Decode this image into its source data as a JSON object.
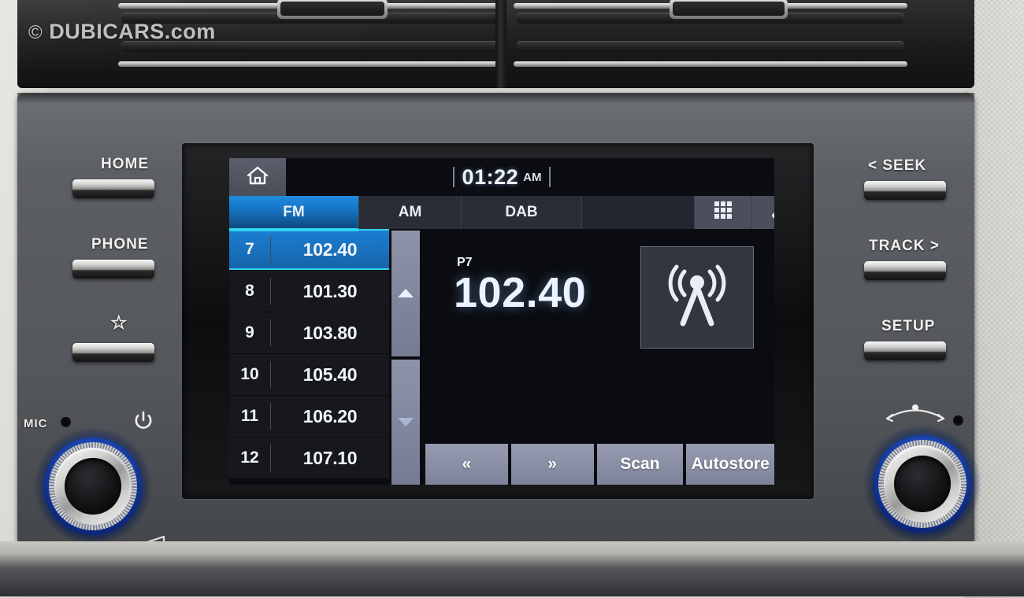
{
  "watermark": {
    "copyright": "©",
    "text": "DUBICARS.com"
  },
  "screen": {
    "status": {
      "home_icon": "home-icon",
      "clock_time": "01:22",
      "clock_ampm": "AM"
    },
    "tabs": [
      {
        "label": "FM",
        "active": true
      },
      {
        "label": "AM",
        "active": false
      },
      {
        "label": "DAB",
        "active": false
      }
    ],
    "tab_icons": [
      {
        "name": "apps-grid-icon"
      },
      {
        "name": "back-arrow-icon"
      }
    ],
    "presets": {
      "scroll_up_icon": "caret-up-icon",
      "scroll_down_icon": "caret-down-icon",
      "rows": [
        {
          "num": "7",
          "freq": "102.40",
          "active": true
        },
        {
          "num": "8",
          "freq": "101.30",
          "active": false
        },
        {
          "num": "9",
          "freq": "103.80",
          "active": false
        },
        {
          "num": "10",
          "freq": "105.40",
          "active": false
        },
        {
          "num": "11",
          "freq": "106.20",
          "active": false
        },
        {
          "num": "12",
          "freq": "107.10",
          "active": false
        }
      ]
    },
    "tuner": {
      "preset_label": "P7",
      "frequency": "102.40",
      "station_icon": "radio-tower-icon"
    },
    "controls": [
      {
        "label": "«",
        "name": "seek-down-button"
      },
      {
        "label": "»",
        "name": "seek-up-button"
      },
      {
        "label": "Scan",
        "name": "scan-button"
      },
      {
        "label": "Autostore",
        "name": "autostore-button"
      }
    ]
  },
  "hard_buttons": {
    "left": [
      {
        "label": "HOME",
        "name": "home-hard-button"
      },
      {
        "label": "PHONE",
        "name": "phone-hard-button"
      },
      {
        "label": "☆",
        "name": "favorite-hard-button"
      }
    ],
    "right": [
      {
        "label": "< SEEK",
        "name": "seek-hard-button"
      },
      {
        "label": "TRACK >",
        "name": "track-hard-button"
      },
      {
        "label": "SETUP",
        "name": "setup-hard-button"
      }
    ]
  },
  "knobs": {
    "left": {
      "mic_label": "MIC",
      "power_icon": "power-icon",
      "volume_icon": "volume-triangle-icon",
      "name": "power-volume-knob"
    },
    "right": {
      "tune_icon": "tune-arc-icon",
      "name": "tune-select-knob"
    }
  },
  "colors": {
    "accent_blue": "#1f8ce0",
    "accent_cyan": "#2fd6ef",
    "screen_bg": "#0a0c11",
    "button_gray": "#8e93a8",
    "knob_ring_blue": "#1f4dbd"
  }
}
